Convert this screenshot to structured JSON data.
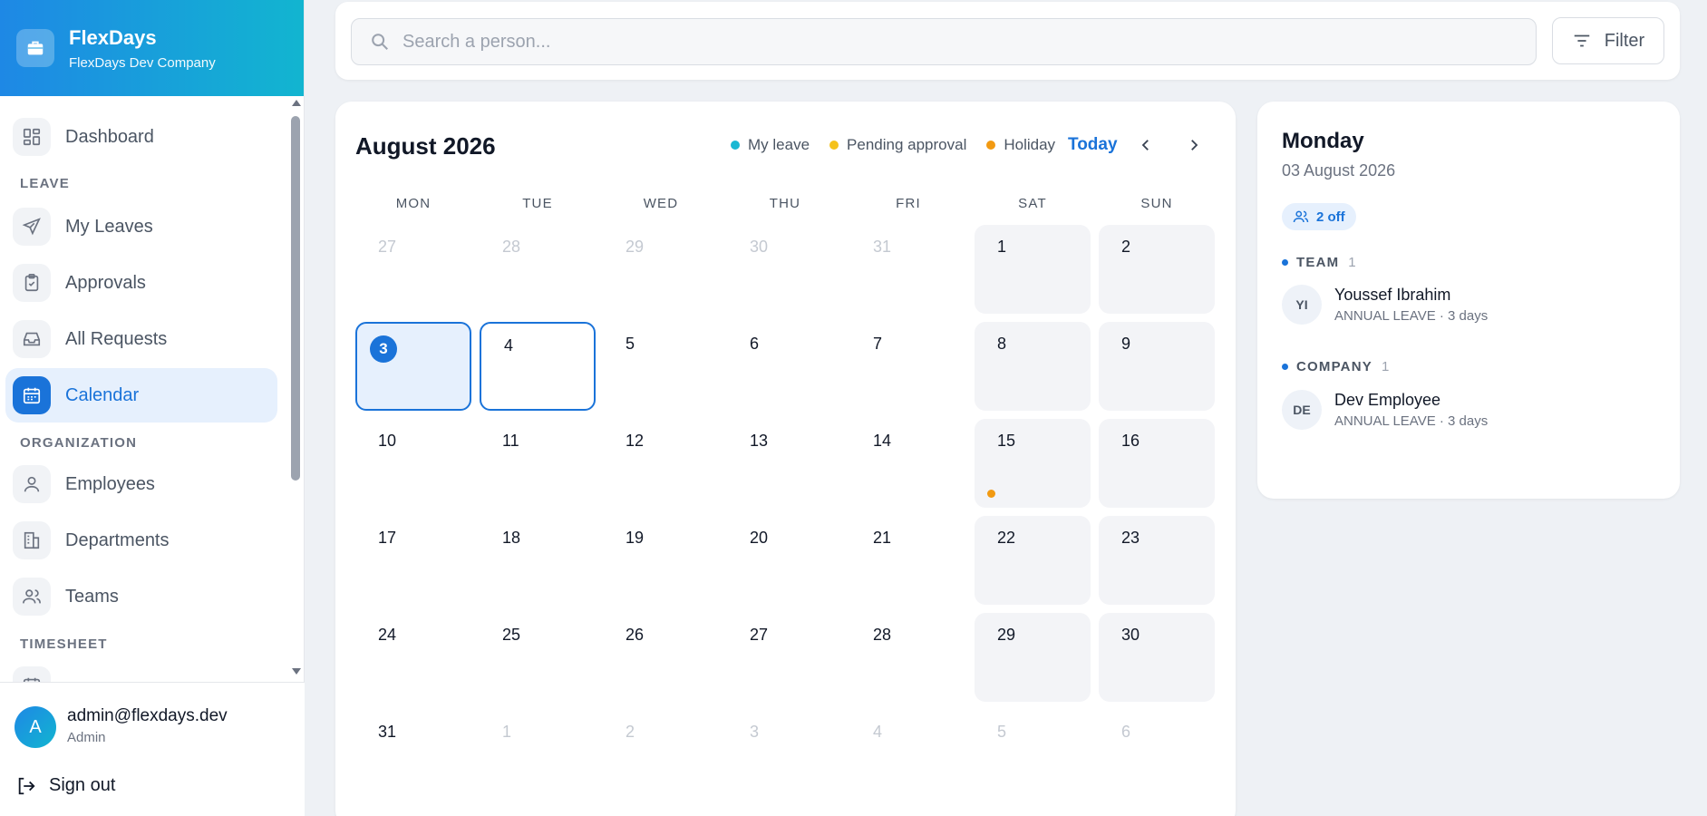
{
  "brand": {
    "title": "FlexDays",
    "subtitle": "FlexDays Dev Company"
  },
  "sidebar": {
    "dashboard": "Dashboard",
    "section_leave": "LEAVE",
    "my_leaves": "My Leaves",
    "approvals": "Approvals",
    "all_requests": "All Requests",
    "calendar": "Calendar",
    "section_org": "ORGANIZATION",
    "employees": "Employees",
    "departments": "Departments",
    "teams": "Teams",
    "section_timesheet": "TIMESHEET"
  },
  "user": {
    "initial": "A",
    "email": "admin@flexdays.dev",
    "role": "Admin",
    "signout": "Sign out"
  },
  "search": {
    "placeholder": "Search a person..."
  },
  "filter": {
    "label": "Filter"
  },
  "calendar": {
    "month_title": "August 2026",
    "legend": {
      "my_leave": "My leave",
      "pending": "Pending approval",
      "holiday": "Holiday"
    },
    "legend_colors": {
      "my_leave": "#19b8d3",
      "pending": "#f5c21b",
      "holiday": "#f29a12"
    },
    "today": "Today",
    "weekdays": [
      "MON",
      "TUE",
      "WED",
      "THU",
      "FRI",
      "SAT",
      "SUN"
    ],
    "weeks": [
      [
        "27",
        "28",
        "29",
        "30",
        "31",
        "1",
        "2"
      ],
      [
        "3",
        "4",
        "5",
        "6",
        "7",
        "8",
        "9"
      ],
      [
        "10",
        "11",
        "12",
        "13",
        "14",
        "15",
        "16"
      ],
      [
        "17",
        "18",
        "19",
        "20",
        "21",
        "22",
        "23"
      ],
      [
        "24",
        "25",
        "26",
        "27",
        "28",
        "29",
        "30"
      ],
      [
        "31",
        "1",
        "2",
        "3",
        "4",
        "5",
        "6"
      ]
    ]
  },
  "detail": {
    "day": "Monday",
    "date": "03 August 2026",
    "off_badge": "2 off",
    "team": {
      "label": "TEAM",
      "count": "1",
      "initials": "YI",
      "name": "Youssef Ibrahim",
      "sub": "ANNUAL LEAVE · 3 days"
    },
    "company": {
      "label": "COMPANY",
      "count": "1",
      "initials": "DE",
      "name": "Dev Employee",
      "sub": "ANNUAL LEAVE · 3 days"
    }
  }
}
